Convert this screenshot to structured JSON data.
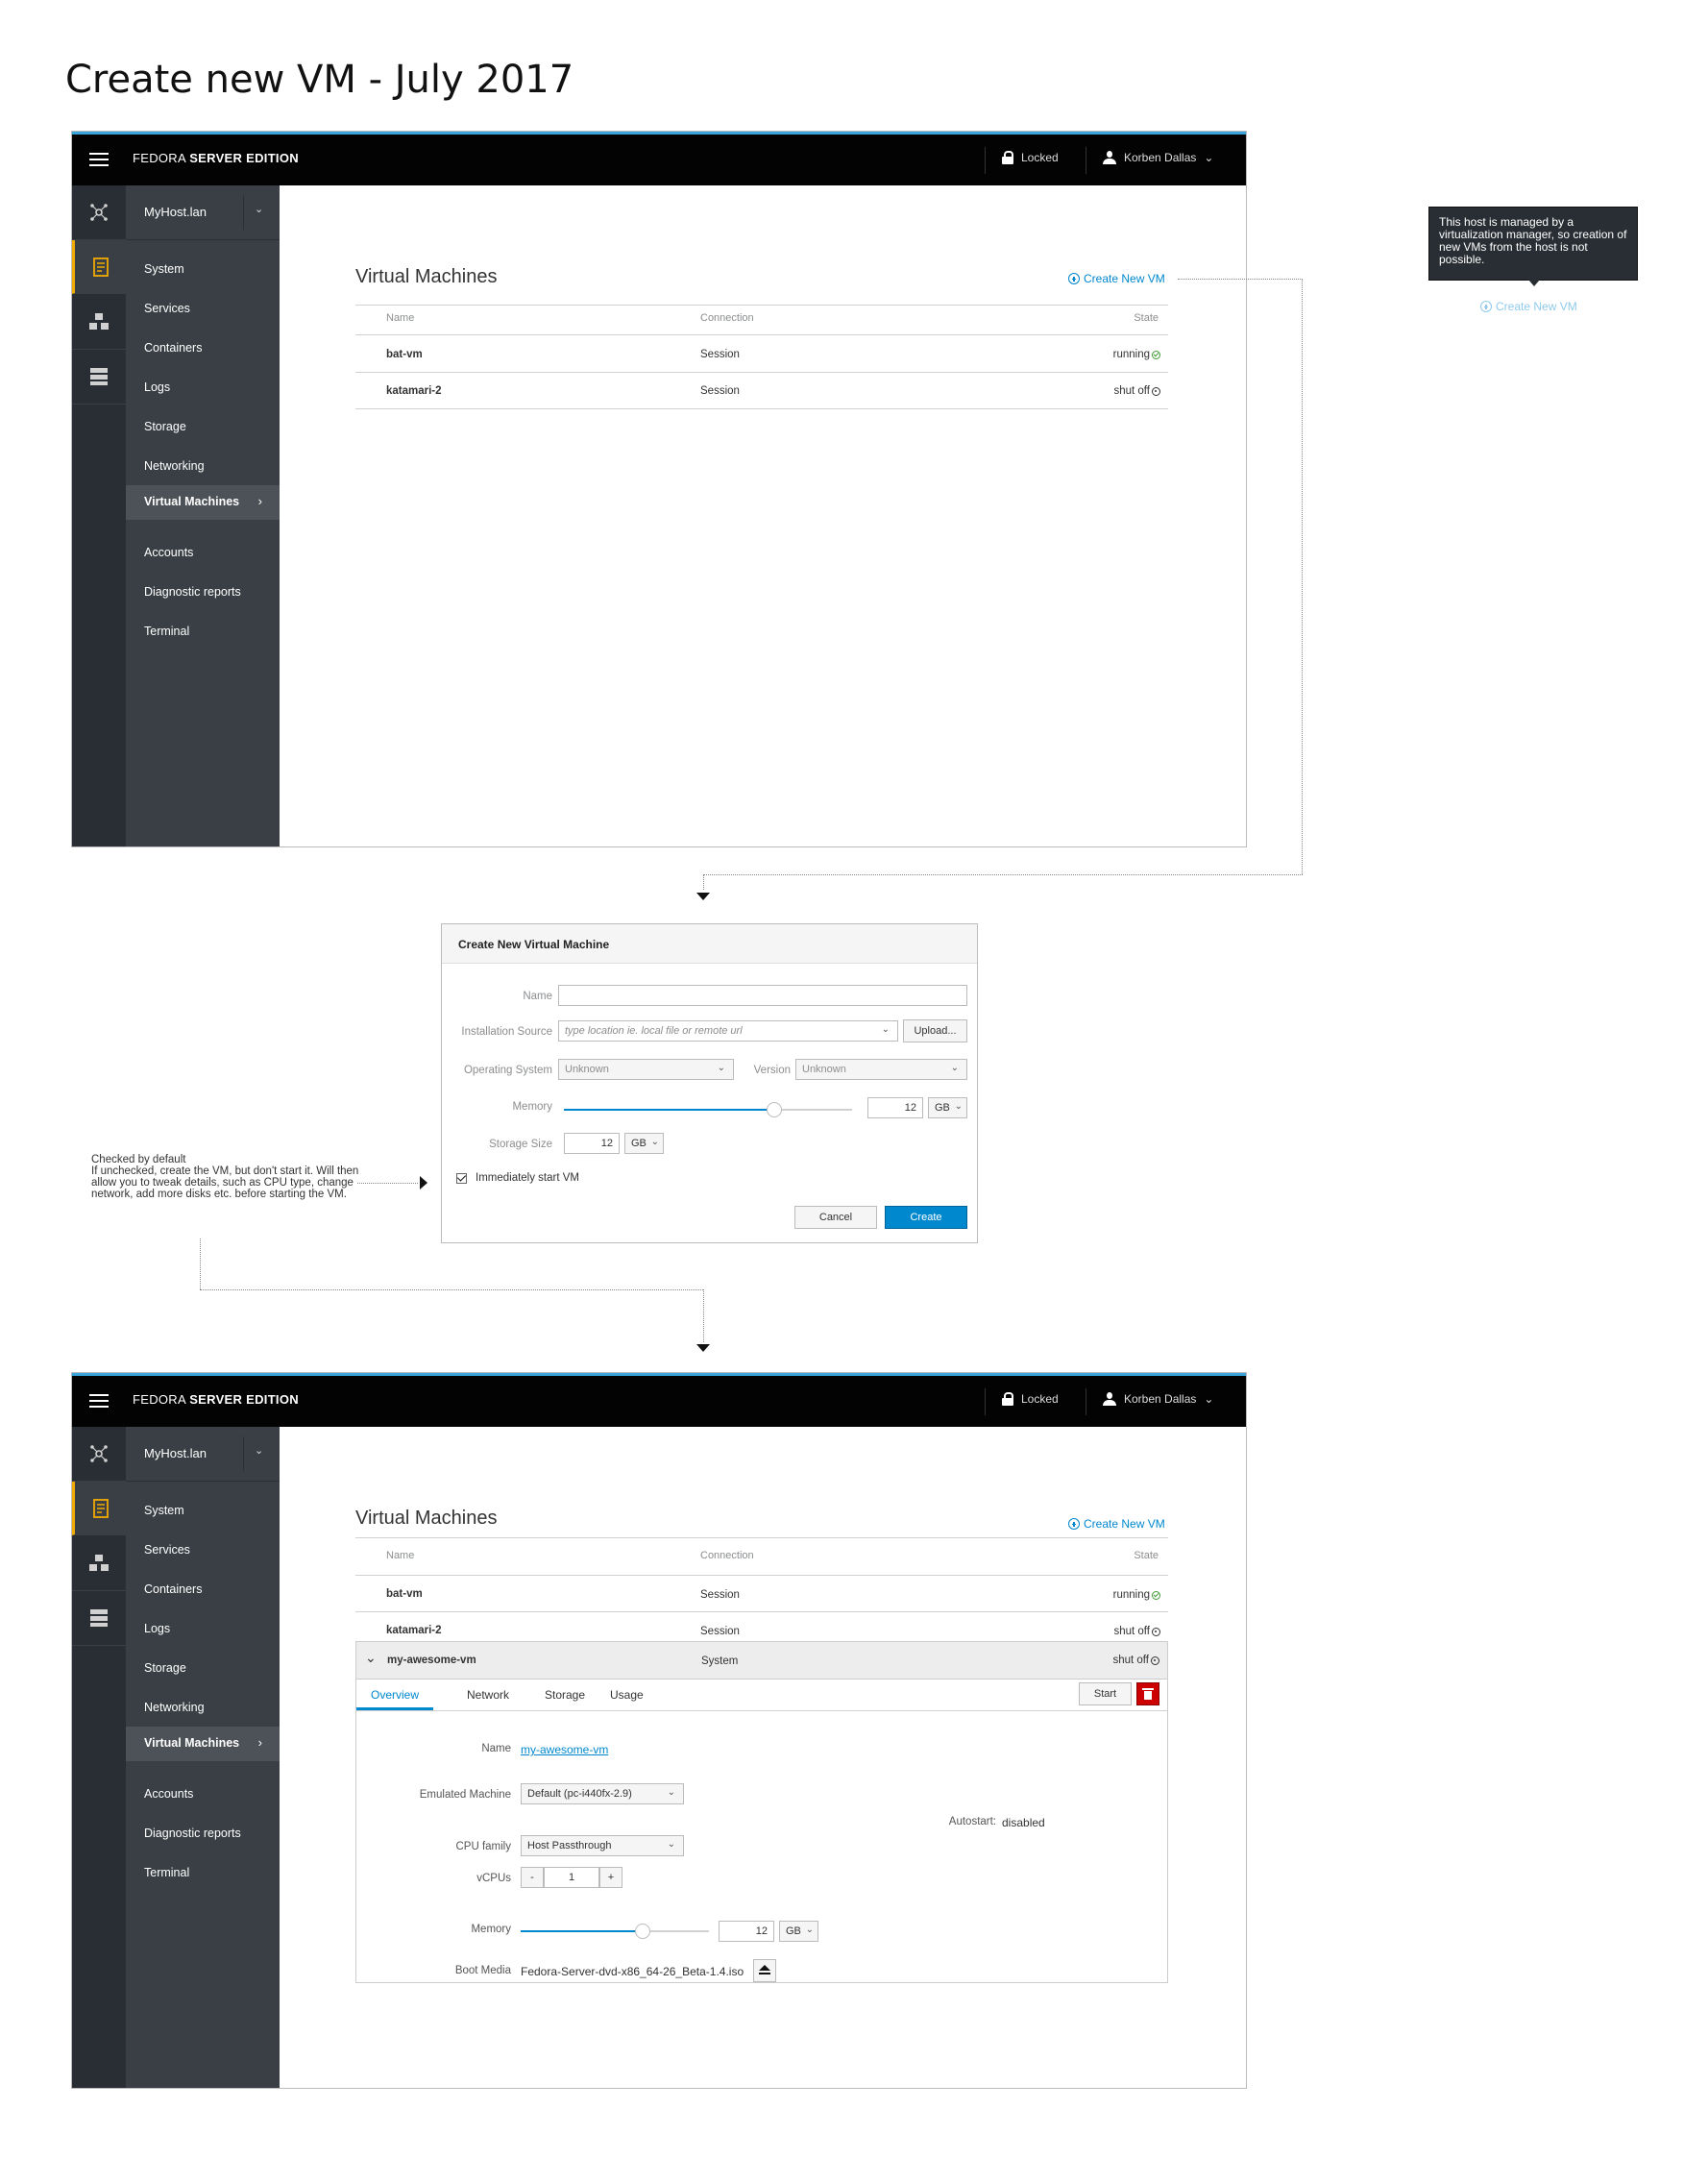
{
  "page_title": "Create new VM - July 2017",
  "header": {
    "brand_light": "FEDORA",
    "brand_bold": "SERVER EDITION",
    "locked": "Locked",
    "user": "Korben Dallas"
  },
  "host": "MyHost.lan",
  "nav": {
    "items": [
      "System",
      "Services",
      "Containers",
      "Logs",
      "Storage",
      "Networking",
      "Virtual Machines",
      "Accounts",
      "Diagnostic reports",
      "Terminal"
    ],
    "active": "Virtual Machines"
  },
  "vms": {
    "title": "Virtual Machines",
    "create_label": "Create New VM",
    "columns": [
      "Name",
      "Connection",
      "State"
    ],
    "rows": [
      {
        "name": "bat-vm",
        "connection": "Session",
        "state": "running"
      },
      {
        "name": "katamari-2",
        "connection": "Session",
        "state": "shut off"
      }
    ],
    "new_row": {
      "name": "my-awesome-vm",
      "connection": "System",
      "state": "shut off"
    }
  },
  "tooltip": {
    "text": "This host is managed by a virtualization manager, so creation of new VMs from the host is not possible.",
    "disabled_link": "Create New VM"
  },
  "dialog": {
    "title": "Create New Virtual Machine",
    "name_label": "Name",
    "name_value": "",
    "source_label": "Installation Source",
    "source_placeholder": "type location ie. local file or remote url",
    "upload": "Upload...",
    "os_label": "Operating System",
    "os_value": "Unknown",
    "version_label": "Version",
    "version_value": "Unknown",
    "memory_label": "Memory",
    "memory_value": "12",
    "memory_unit": "GB",
    "memory_slider_fraction": 0.73,
    "storage_label": "Storage Size",
    "storage_value": "12",
    "storage_unit": "GB",
    "start_label": "Immediately start VM",
    "cancel": "Cancel",
    "create": "Create"
  },
  "note": {
    "line1": "Checked by default",
    "line2": "If unchecked, create the VM, but don't start it. Will then allow you to tweak details, such as CPU type, change network, add more disks etc. before starting the VM."
  },
  "details": {
    "tabs": [
      "Overview",
      "Network",
      "Storage",
      "Usage"
    ],
    "active_tab": "Overview",
    "start": "Start",
    "name_label": "Name",
    "name_value": "my-awesome-vm",
    "machine_label": "Emulated Machine",
    "machine_value": "Default (pc-i440fx-2.9)",
    "autostart_label": "Autostart:",
    "autostart_value": "disabled",
    "cpu_label": "CPU family",
    "cpu_value": "Host Passthrough",
    "vcpu_label": "vCPUs",
    "vcpu_minus": "-",
    "vcpu_value": "1",
    "vcpu_plus": "+",
    "memory_label": "Memory",
    "memory_value": "12",
    "memory_unit": "GB",
    "memory_slider_fraction": 0.65,
    "boot_label": "Boot Media",
    "boot_value": "Fedora-Server-dvd-x86_64-26_Beta-1.4.iso"
  },
  "colors": {
    "accent": "#0088ce",
    "masthead": "#030303",
    "masthead_border": "#39a5dc",
    "nav_bg": "#393f44",
    "rail_bg": "#292e34",
    "active_marker": "#f0ab00",
    "running": "#3f9c35",
    "danger": "#cc0000"
  },
  "icons": [
    "hamburger-icon",
    "lock-icon",
    "user-icon",
    "chevron-down-icon",
    "network-hub-icon",
    "dashboard-icon",
    "cluster-icon",
    "server-icon",
    "plus-circle-icon",
    "check-circle-icon",
    "off-circle-icon",
    "trash-icon",
    "eject-icon"
  ]
}
